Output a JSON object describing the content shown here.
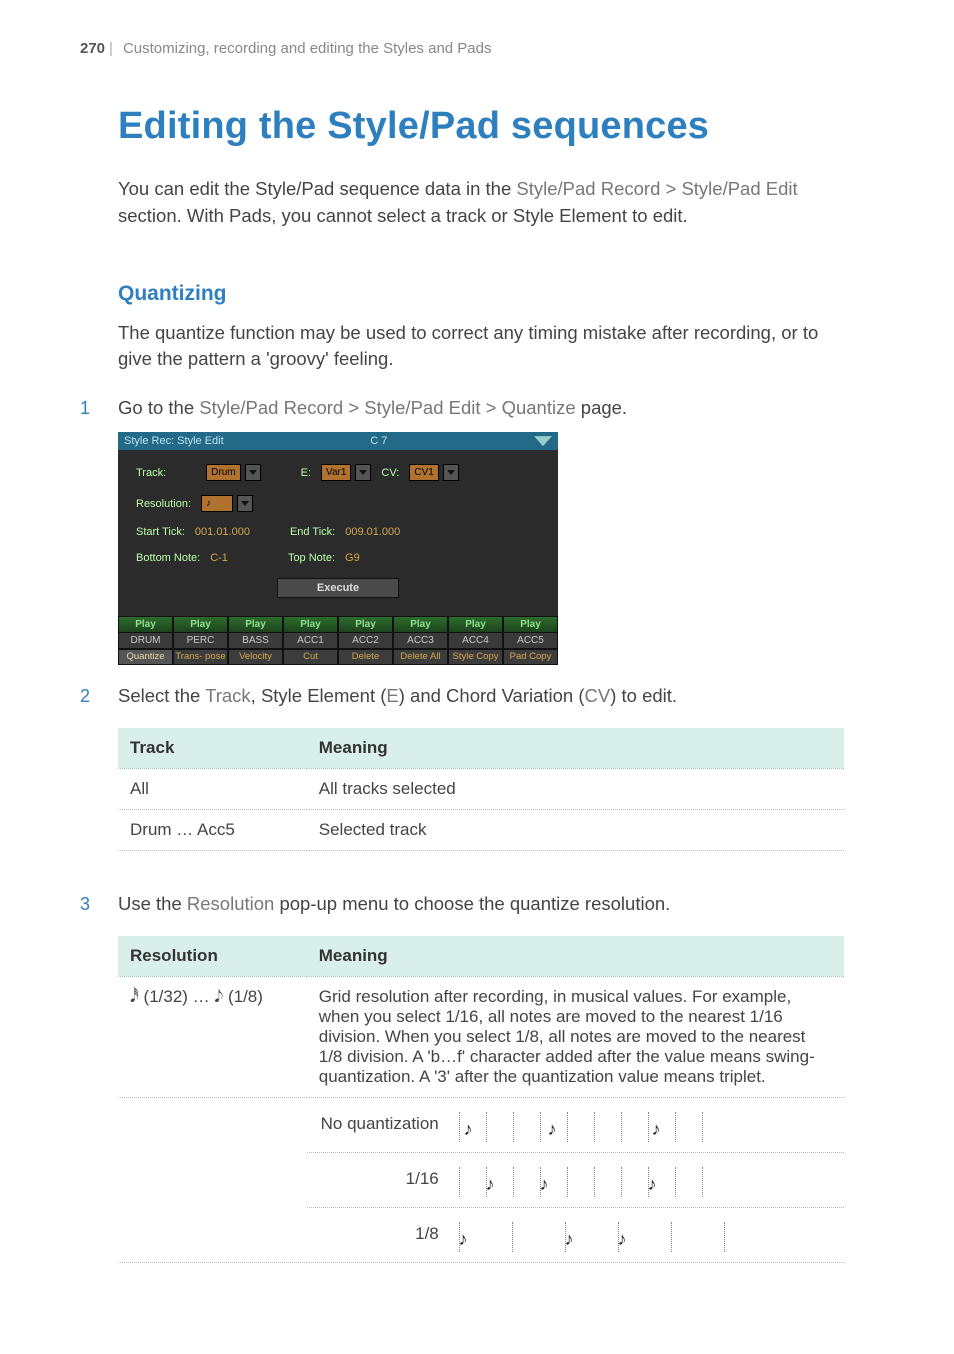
{
  "header": {
    "page_number": "270",
    "bar": "|",
    "chapter": "Customizing, recording and editing the Styles and Pads"
  },
  "title": "Editing the Style/Pad sequences",
  "intro": {
    "pre": "You can edit the Style/Pad sequence data in the ",
    "path": "Style/Pad Record > Style/Pad Edit",
    "post": " section. With Pads, you cannot select a track or Style Element to edit."
  },
  "section_quantizing": "Quantizing",
  "quantizing_body": "The quantize function may be used to correct any timing mistake after recording, or to give the pattern a 'groovy' feeling.",
  "step1": {
    "num": "1",
    "pre": "Go to the ",
    "path": "Style/Pad Record > Style/Pad Edit > Quantize",
    "post": " page."
  },
  "device": {
    "titlebar_left": "Style Rec: Style Edit",
    "titlebar_center": "C 7",
    "track_label": "Track:",
    "track_value": "Drum",
    "e_label": "E:",
    "e_value": "Var1",
    "cv_label": "CV:",
    "cv_value": "CV1",
    "resolution_label": "Resolution:",
    "resolution_value": "♪",
    "start_tick_label": "Start Tick:",
    "start_tick_value": "001.01.000",
    "end_tick_label": "End Tick:",
    "end_tick_value": "009.01.000",
    "bottom_note_label": "Bottom Note:",
    "bottom_note_value": "C-1",
    "top_note_label": "Top Note:",
    "top_note_value": "G9",
    "execute": "Execute",
    "play": "Play",
    "tracks": [
      "DRUM",
      "PERC",
      "BASS",
      "ACC1",
      "ACC2",
      "ACC3",
      "ACC4",
      "ACC5"
    ],
    "tabs": [
      "Quantize",
      "Trans-\npose",
      "Velocity",
      "Cut",
      "Delete",
      "Delete\nAll",
      "Style\nCopy",
      "Pad\nCopy"
    ]
  },
  "step2": {
    "num": "2",
    "pre": "Select the ",
    "k1": "Track",
    "mid1": ", Style Element (",
    "k2": "E",
    "mid2": ") and Chord Variation (",
    "k3": "CV",
    "post": ") to edit."
  },
  "table1": {
    "h1": "Track",
    "h2": "Meaning",
    "r1c1": "All",
    "r1c2": "All tracks selected",
    "r2c1": "Drum … Acc5",
    "r2c2": "Selected track"
  },
  "step3": {
    "num": "3",
    "pre": "Use the ",
    "k1": "Resolution",
    "post": " pop-up menu to choose the quantize resolution."
  },
  "table2": {
    "h1": "Resolution",
    "h2": "Meaning",
    "r1c1_a": "(1/32) … ",
    "r1c1_b": "(1/8)",
    "r1c2": "Grid resolution after recording, in musical values. For example, when you select 1/16, all notes are moved to the nearest 1/16 division. When you select 1/8, all notes are moved to the nearest 1/8 division. A 'b…f' character added after the value means swing-quantization. A '3' after the quantization value means triplet.",
    "noq": "No quantization",
    "s16": "1/16",
    "s8": "1/8"
  }
}
